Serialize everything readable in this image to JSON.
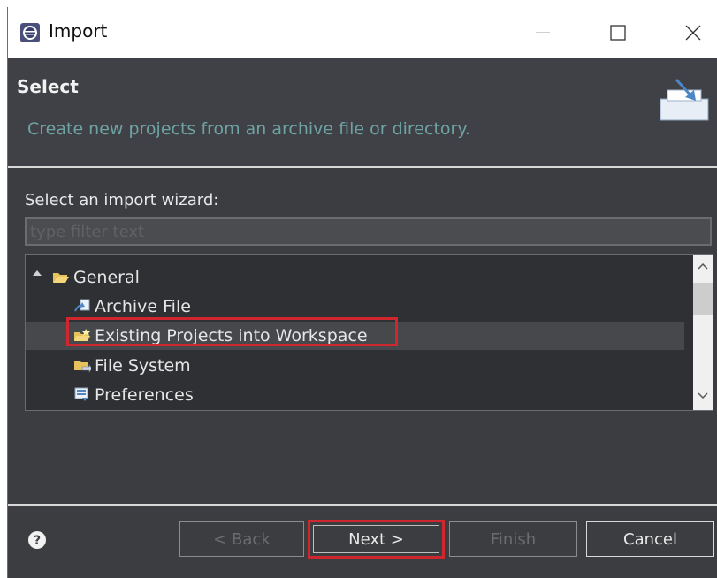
{
  "window": {
    "title": "Import",
    "minimize_symbol": "—",
    "maximize_symbol": "☐",
    "close_symbol": "✕"
  },
  "header": {
    "title": "Select",
    "description": "Create new projects from an archive file or directory."
  },
  "wizard": {
    "label": "Select an import wizard:",
    "filter_placeholder": "type filter text",
    "filter_value": ""
  },
  "tree": {
    "items": [
      {
        "label": "General",
        "icon": "folder-open-icon",
        "level": 0,
        "expanded": true
      },
      {
        "label": "Archive File",
        "icon": "archive-file-icon",
        "level": 1
      },
      {
        "label": "Existing Projects into Workspace",
        "icon": "existing-projects-icon",
        "level": 1,
        "selected": true
      },
      {
        "label": "File System",
        "icon": "file-system-icon",
        "level": 1
      },
      {
        "label": "Preferences",
        "icon": "preferences-icon",
        "level": 1
      }
    ]
  },
  "buttons": {
    "back": "< Back",
    "next": "Next >",
    "finish": "Finish",
    "cancel": "Cancel"
  },
  "colors": {
    "highlight": "#d0262d",
    "description_text": "#6fa3a3",
    "dialog_bg": "#3b3d40"
  }
}
